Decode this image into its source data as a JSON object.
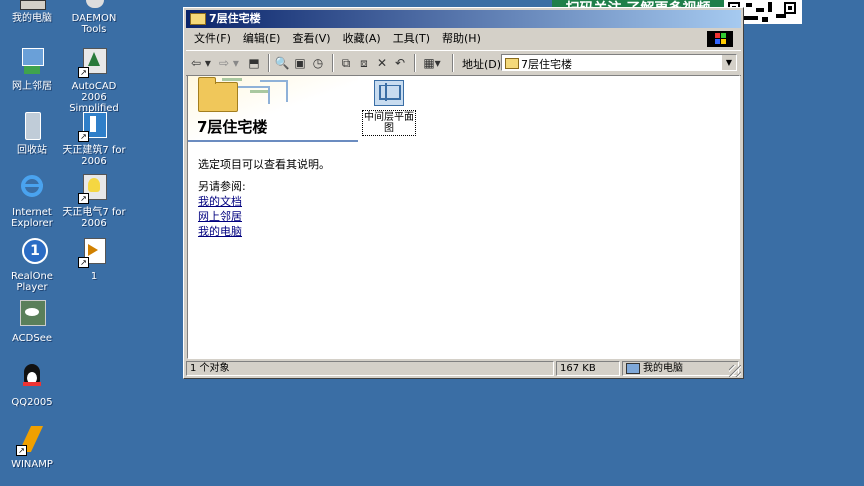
{
  "desktop_icons": [
    {
      "label": "我的电脑"
    },
    {
      "label": "DAEMON Tools"
    },
    {
      "label": "网上邻居"
    },
    {
      "label": "AutoCAD 2006 Simplified C..."
    },
    {
      "label": "回收站"
    },
    {
      "label": "天正建筑7 for 2006"
    },
    {
      "label": "Internet Explorer"
    },
    {
      "label": "天正电气7 for 2006"
    },
    {
      "label": "RealOne Player"
    },
    {
      "label": "1"
    },
    {
      "label": "ACDSee"
    },
    {
      "label": "QQ2005"
    },
    {
      "label": "WINAMP"
    }
  ],
  "banner": {
    "text": "扫码关注 了解更多视频"
  },
  "window": {
    "title": "7层住宅楼",
    "menu": [
      "文件(F)",
      "编辑(E)",
      "查看(V)",
      "收藏(A)",
      "工具(T)",
      "帮助(H)"
    ],
    "address_label": "地址(D)",
    "address_value": "7层住宅楼"
  },
  "content": {
    "folder_title": "7层住宅楼",
    "description": "选定项目可以查看其说明。",
    "see_also": "另请参阅:",
    "links": [
      "我的文档",
      "网上邻居",
      "我的电脑"
    ],
    "file": {
      "label": "中间层平面图"
    }
  },
  "status": {
    "count": "1 个对象",
    "size": "167 KB",
    "location": "我的电脑"
  },
  "colors": {
    "desktop": "#3a6ea5",
    "titlebar_start": "#0a246a",
    "titlebar_end": "#a6caf0"
  }
}
